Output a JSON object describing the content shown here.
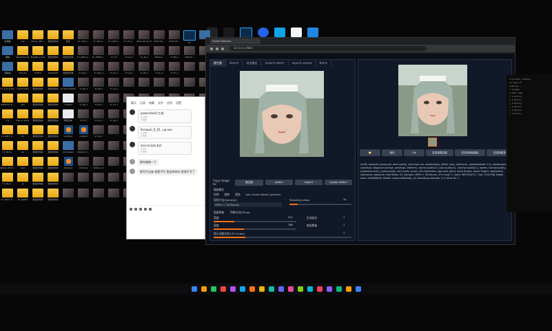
{
  "desktop": {
    "icons": [
      {
        "kind": "exe",
        "label": "此电脑"
      },
      {
        "kind": "folder",
        "label": "ueb"
      },
      {
        "kind": "folder",
        "label": "dolder_diffu..."
      },
      {
        "kind": "folder",
        "label": "新建文件夹"
      },
      {
        "kind": "folder",
        "label": "作业"
      },
      {
        "kind": "img",
        "label": "17_4d5_t..."
      },
      {
        "kind": "img",
        "label": "17_d93_t..."
      },
      {
        "kind": "img",
        "label": "17_1d8_t..."
      },
      {
        "kind": "img",
        "label": "17_b2_t..."
      },
      {
        "kind": "img",
        "label": "2023-04-01_09..."
      },
      {
        "kind": "img",
        "label": "2023-05..."
      },
      {
        "kind": "img",
        "label": "2023-05..."
      },
      {
        "kind": "ps",
        "label": "Ps"
      },
      {
        "kind": "exe",
        "label": ""
      },
      {
        "kind": "exe",
        "label": "网络"
      },
      {
        "kind": "folder",
        "label": "SteamCache"
      },
      {
        "kind": "folder",
        "label": "PixelPlus_Fine"
      },
      {
        "kind": "folder",
        "label": "新建文件夹"
      },
      {
        "kind": "folder",
        "label": "新建文件夹"
      },
      {
        "kind": "img",
        "label": "17_9950_t..."
      },
      {
        "kind": "img",
        "label": "17_9958_t..."
      },
      {
        "kind": "img",
        "label": "17_hd"
      },
      {
        "kind": "img",
        "label": "17_4d_t"
      },
      {
        "kind": "img",
        "label": "17_4e_t"
      },
      {
        "kind": "img",
        "label": "2023-0..."
      },
      {
        "kind": "img",
        "label": "17_6b_t"
      },
      {
        "kind": "img",
        "label": "2023-0..."
      },
      {
        "kind": "img",
        "label": ""
      },
      {
        "kind": "exe",
        "label": "回收站"
      },
      {
        "kind": "folder",
        "label": "hanchu"
      },
      {
        "kind": "folder",
        "label": "brifind"
      },
      {
        "kind": "folder",
        "label": "Hentai2D"
      },
      {
        "kind": "folder",
        "label": "新建文件夹"
      },
      {
        "kind": "img",
        "label": "17_8b_t..."
      },
      {
        "kind": "img",
        "label": "17_9ba_t"
      },
      {
        "kind": "img",
        "label": "17_4c_t"
      },
      {
        "kind": "img",
        "label": "17_ee_t"
      },
      {
        "kind": "img",
        "label": "17_8d_t"
      },
      {
        "kind": "img",
        "label": "17_5c_t"
      },
      {
        "kind": "img",
        "label": "17_5c_t"
      },
      {
        "kind": "img",
        "label": ""
      },
      {
        "kind": "img",
        "label": ""
      },
      {
        "kind": "folder",
        "label": "17_0_2_Super"
      },
      {
        "kind": "folder",
        "label": "hyuhhubba"
      },
      {
        "kind": "folder",
        "label": "新建文件夹"
      },
      {
        "kind": "folder",
        "label": "新建文件夹"
      },
      {
        "kind": "exe",
        "label": "Scratch Desktop"
      },
      {
        "kind": "img",
        "label": "17_9b_t"
      },
      {
        "kind": "img",
        "label": "17_40_t"
      },
      {
        "kind": "img",
        "label": "17_c2_t"
      },
      {
        "kind": "img",
        "label": ""
      },
      {
        "kind": "img",
        "label": ""
      },
      {
        "kind": "img",
        "label": ""
      },
      {
        "kind": "img",
        "label": ""
      },
      {
        "kind": "img",
        "label": ""
      },
      {
        "kind": "img",
        "label": ""
      },
      {
        "kind": "folder",
        "label": "00009 [1:5..."
      },
      {
        "kind": "folder",
        "label": "kkxi"
      },
      {
        "kind": "folder",
        "label": "新建文件夹"
      },
      {
        "kind": "folder",
        "label": "新建文件夹"
      },
      {
        "kind": "doc",
        "label": "untitled"
      },
      {
        "kind": "img",
        "label": "17_99_t"
      },
      {
        "kind": "img",
        "label": "17_5b_t"
      },
      {
        "kind": "img",
        "label": "17_07_t"
      },
      {
        "kind": "img",
        "label": ""
      },
      {
        "kind": "img",
        "label": ""
      },
      {
        "kind": "img",
        "label": ""
      },
      {
        "kind": "img",
        "label": ""
      },
      {
        "kind": "img",
        "label": ""
      },
      {
        "kind": "img",
        "label": ""
      },
      {
        "kind": "folder",
        "label": "F:1"
      },
      {
        "kind": "folder",
        "label": "free ai demo"
      },
      {
        "kind": "folder",
        "label": "新建文件夹"
      },
      {
        "kind": "folder",
        "label": "新建文件夹"
      },
      {
        "kind": "doc",
        "label": "新建文本"
      },
      {
        "kind": "img",
        "label": "17_ff_t"
      },
      {
        "kind": "img",
        "label": "17_2c_t"
      },
      {
        "kind": "img",
        "label": "17_bb_t"
      },
      {
        "kind": "img",
        "label": ""
      },
      {
        "kind": "img",
        "label": ""
      },
      {
        "kind": "img",
        "label": ""
      },
      {
        "kind": "img",
        "label": ""
      },
      {
        "kind": "img",
        "label": ""
      },
      {
        "kind": "img",
        "label": ""
      },
      {
        "kind": "folder",
        "label": "17_9b17_F..."
      },
      {
        "kind": "folder",
        "label": "F:1"
      },
      {
        "kind": "folder",
        "label": "新建文件夹"
      },
      {
        "kind": "folder",
        "label": "新建文件夹"
      },
      {
        "kind": "blend",
        "label": "untitled"
      },
      {
        "kind": "blend",
        "label": "untitled"
      },
      {
        "kind": "img",
        "label": "17_8e_t"
      },
      {
        "kind": "img",
        "label": ""
      },
      {
        "kind": "img",
        "label": ""
      },
      {
        "kind": "img",
        "label": ""
      },
      {
        "kind": "img",
        "label": ""
      },
      {
        "kind": "img",
        "label": ""
      },
      {
        "kind": "img",
        "label": ""
      },
      {
        "kind": "img",
        "label": ""
      },
      {
        "kind": "folder",
        "label": "17_9f_N..."
      },
      {
        "kind": "folder",
        "label": "ad"
      },
      {
        "kind": "folder",
        "label": "新建文件夹"
      },
      {
        "kind": "folder",
        "label": "新建文件夹"
      },
      {
        "kind": "exe",
        "label": "dhcs.blend"
      },
      {
        "kind": "img",
        "label": "00099_17..."
      },
      {
        "kind": "img",
        "label": ""
      },
      {
        "kind": "img",
        "label": ""
      },
      {
        "kind": "img",
        "label": ""
      },
      {
        "kind": "img",
        "label": ""
      },
      {
        "kind": "img",
        "label": ""
      },
      {
        "kind": "img",
        "label": ""
      },
      {
        "kind": "img",
        "label": ""
      },
      {
        "kind": "img",
        "label": ""
      },
      {
        "kind": "folder",
        "label": "00044_1527..."
      },
      {
        "kind": "folder",
        "label": "test"
      },
      {
        "kind": "folder",
        "label": "新建文件夹"
      },
      {
        "kind": "folder",
        "label": "新建文件夹"
      },
      {
        "kind": "blend",
        "label": "dtnterial"
      },
      {
        "kind": "img",
        "label": "dtnterial"
      },
      {
        "kind": "img",
        "label": "00091_11"
      },
      {
        "kind": "img",
        "label": ""
      },
      {
        "kind": "img",
        "label": ""
      },
      {
        "kind": "img",
        "label": ""
      },
      {
        "kind": "img",
        "label": ""
      },
      {
        "kind": "img",
        "label": ""
      },
      {
        "kind": "img",
        "label": ""
      },
      {
        "kind": "img",
        "label": ""
      },
      {
        "kind": "folder",
        "label": "17_9b_S..."
      },
      {
        "kind": "folder",
        "label": "gl"
      },
      {
        "kind": "folder",
        "label": "新建文件夹"
      },
      {
        "kind": "folder",
        "label": "新建文件夹"
      },
      {
        "kind": "img",
        "label": ""
      },
      {
        "kind": "img",
        "label": ""
      },
      {
        "kind": "img",
        "label": ""
      },
      {
        "kind": "img",
        "label": ""
      },
      {
        "kind": "img",
        "label": ""
      },
      {
        "kind": "img",
        "label": ""
      },
      {
        "kind": "img",
        "label": ""
      },
      {
        "kind": "img",
        "label": ""
      },
      {
        "kind": "img",
        "label": ""
      },
      {
        "kind": "img",
        "label": ""
      },
      {
        "kind": "folder",
        "label": "17_9b17_9..."
      },
      {
        "kind": "folder",
        "label": "wl_swiftel"
      },
      {
        "kind": "folder",
        "label": "新建文件夹"
      },
      {
        "kind": "folder",
        "label": "新建文件夹"
      },
      {
        "kind": "img",
        "label": ""
      },
      {
        "kind": "img",
        "label": ""
      },
      {
        "kind": "img",
        "label": ""
      },
      {
        "kind": "img",
        "label": ""
      },
      {
        "kind": "img",
        "label": ""
      },
      {
        "kind": "img",
        "label": ""
      },
      {
        "kind": "img",
        "label": ""
      },
      {
        "kind": "img",
        "label": ""
      },
      {
        "kind": "img",
        "label": ""
      },
      {
        "kind": "img",
        "label": ""
      }
    ]
  },
  "chat": {
    "tabs": [
      "聊天",
      "记录",
      "收藏",
      "文件",
      "应用",
      "设置"
    ],
    "messages": [
      {
        "title": "powershell小工具",
        "sub": "14.6kb",
        "time": "已发送"
      },
      {
        "title": "fixrepair_9_25...up.exe",
        "sub": "2.6MB",
        "time": "已发送"
      },
      {
        "title": "lora-scripts.bat",
        "sub": "0.4kb",
        "time": "已发送"
      }
    ],
    "reply1": "那你就跑一下",
    "reply2": "就写不出来 就是不写 是这样的吗 那我不写了",
    "input": ""
  },
  "browser": {
    "tab_title": "Stable Diffusion",
    "url": "127.0.0.1:7860",
    "left_tabs": [
      "图生图",
      "Sketch",
      "局部重绘",
      "Inpaint sketch",
      "Inpaint upload",
      "Batch"
    ],
    "copy_label": "Copy image to:",
    "copy_buttons": [
      "图生图",
      "sketch",
      "inpaint",
      "inpaint sketch"
    ],
    "resize_label": "缩放模式",
    "resize_opts": [
      "拉伸",
      "裁剪",
      "填充",
      "Just resize (latent upscale)"
    ],
    "sampler_label": "采样方法(Sampler)",
    "sampler_value": "DPM++ 2M Karras",
    "steps_label": "Sampling steps",
    "steps_value": "20",
    "restore_label": "面部修复",
    "tiling_label": "平铺/分块(Tiling)",
    "width_label": "宽度",
    "width_value": "512",
    "height_label": "高度",
    "height_value": "768",
    "batch_count_label": "生成批次",
    "batch_count_value": "1",
    "batch_size_label": "每批数量",
    "batch_size_value": "1",
    "cfg_label": "提示词相关性(CFG Scale)",
    "cfg_value": "7",
    "denoise_label": "重绘幅度(Denoising)",
    "denoise_value": "0.45",
    "seed_label": "随机种子(seed)",
    "seed_value": "-1",
    "right_buttons": [
      "📁",
      "保存",
      "Zip",
      "发送到图生图",
      "发送到局部重绘",
      "发送到更多"
    ],
    "info_text": "ae 8K, beautiful young girl, best quality, ultra high res, masterpiece, detail, sexy, soft focus, (photorealistic:1.4), masterpiece, colorstyle, Negative prompt: paintings, sketches, (worst quality:2), (low quality:2), (normal quality:2), lowres, normal quality, ((monochrome)), ((grayscale)), skin spots, acnes, skin blemishes, age spot, glans, extra fingers, fewer fingers, watermark, username, signature, text Steps: 20, Sampler: DPM++ 2M Karras, CFG scale: 7, Seed: 3697400717, Size: 512x768, Model hash: a9b00b8ef0, Model: majicmixRealistic_v4, Denoising strength: 0.4, Hires fix: 1"
  },
  "terminal": {
    "lines": [
      "...",
      "scrollbar_rstatus",
      "is-test-nn",
      "",
      "",
      "Loading ...",
      "",
      "1 loaded",
      "",
      "x-test-rmal",
      "",
      "[  3.2it/s]",
      "[  2.1it/s]",
      "[  2.8it/s]",
      "[  1.9it/s]",
      "[  2.4it/s]",
      "[  3.0it/s]"
    ]
  },
  "taskbar": {
    "items": 18,
    "colors": [
      "#3b82f6",
      "#f59e0b",
      "#22c55e",
      "#ef4444",
      "#a855f7",
      "#0ea5e9",
      "#f97316",
      "#eab308",
      "#14b8a6",
      "#6366f1",
      "#ec4899",
      "#84cc16",
      "#06b6d4",
      "#f43f5e",
      "#8b5cf6",
      "#10b981",
      "#f59e0b",
      "#3b82f6"
    ]
  }
}
